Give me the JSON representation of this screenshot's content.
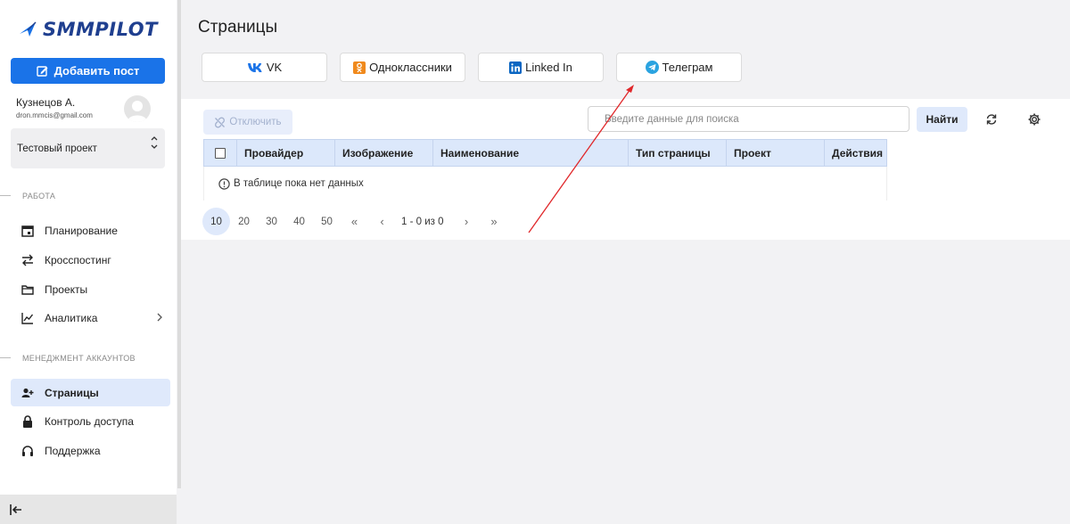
{
  "app": {
    "logo_text": "SMMPILOT",
    "brand_color": "#1a73e8"
  },
  "sidebar": {
    "add_post_label": "Добавить пост",
    "user": {
      "name": "Кузнецов А.",
      "email": "dron.mmcis@gmail.com"
    },
    "project": "Тестовый проект",
    "sections": [
      {
        "title": "РАБОТА",
        "items": [
          {
            "label": "Планирование",
            "icon": "calendar-icon"
          },
          {
            "label": "Кросспостинг",
            "icon": "swap-arrows-icon"
          },
          {
            "label": "Проекты",
            "icon": "folder-icon"
          },
          {
            "label": "Аналитика",
            "icon": "chart-line-icon"
          }
        ]
      },
      {
        "title": "МЕНЕДЖМЕНТ АККАУНТОВ",
        "items": [
          {
            "label": "Страницы",
            "icon": "add-user-icon",
            "active": true
          },
          {
            "label": "Контроль доступа",
            "icon": "lock-icon"
          },
          {
            "label": "Поддержка",
            "icon": "headset-icon"
          }
        ]
      }
    ]
  },
  "main": {
    "title": "Страницы",
    "providers": [
      {
        "label": "VK",
        "icon": "vk-icon"
      },
      {
        "label": "Одноклассники",
        "icon": "odnoklassniki-icon"
      },
      {
        "label": "Linked In",
        "icon": "linkedin-icon"
      },
      {
        "label": "Телеграм",
        "icon": "telegram-icon"
      }
    ],
    "toolbar": {
      "disconnect_label": "Отключить",
      "search_placeholder": "Введите данные для поиска",
      "search_value": "",
      "find_label": "Найти"
    },
    "table": {
      "columns": [
        "Провайдер",
        "Изображение",
        "Наименование",
        "Тип страницы",
        "Проект",
        "Действия"
      ],
      "rows": [],
      "empty_text": "В таблице пока нет данных"
    },
    "pagination": {
      "page_sizes": [
        "10",
        "20",
        "30",
        "40",
        "50"
      ],
      "selected_size": "10",
      "range_text": "1 - 0 из 0"
    }
  },
  "annotation": {
    "arrow_color": "#e0272a"
  }
}
